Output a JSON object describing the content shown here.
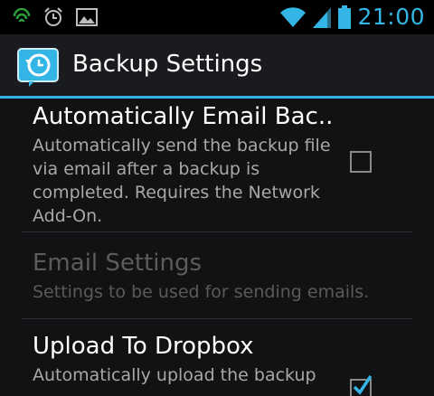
{
  "status_bar": {
    "time": "21:00",
    "icons": [
      "android-shield-icon",
      "alarm-clock-icon",
      "image-icon",
      "wifi-icon",
      "signal-icon",
      "battery-icon"
    ],
    "accent_color": "#33b5e5"
  },
  "action_bar": {
    "title": "Backup Settings",
    "icon": "backup-restore-icon"
  },
  "preferences": [
    {
      "title": "Automatically Email Bac..",
      "summary": "Automatically send the backup file via email after a backup is completed. Requires the Network Add-On.",
      "enabled": true,
      "has_checkbox": true,
      "checked": false
    },
    {
      "title": "Email Settings",
      "summary": "Settings to be used for sending emails.",
      "enabled": false,
      "has_checkbox": false
    },
    {
      "title": "Upload To Dropbox",
      "summary": "Automatically upload the backup",
      "enabled": true,
      "has_checkbox": true,
      "checked": true
    }
  ]
}
